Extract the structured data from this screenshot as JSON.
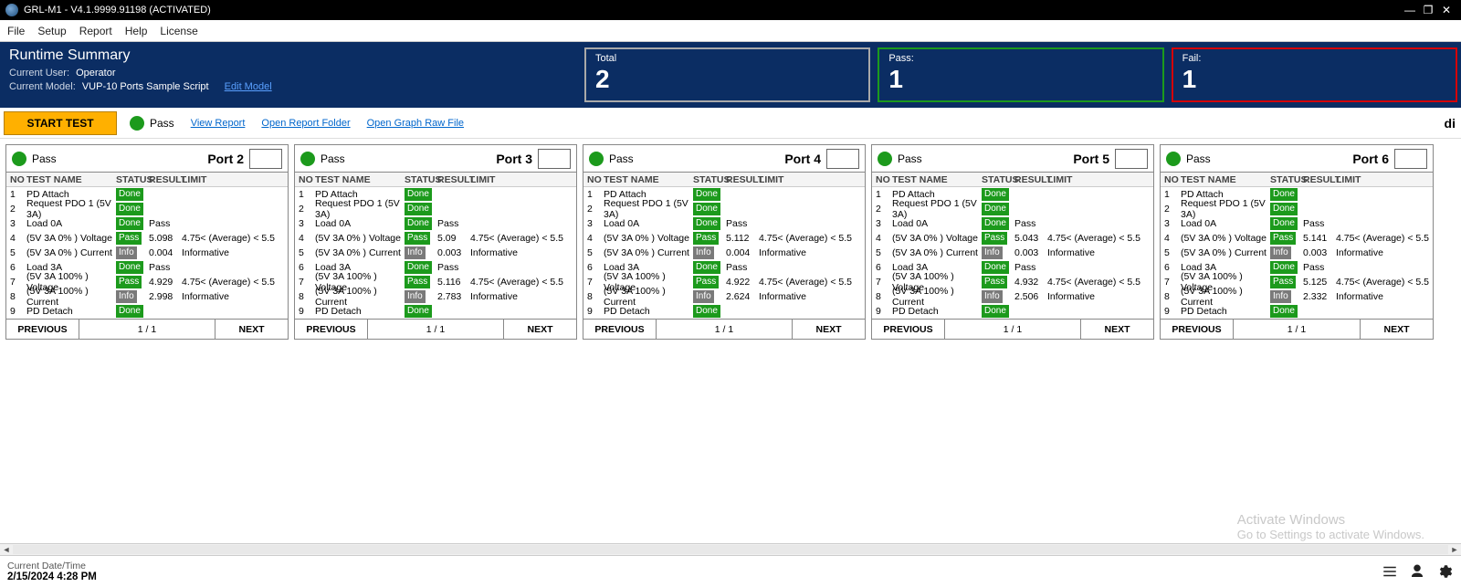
{
  "title_bar": {
    "title": "GRL-M1 - V4.1.9999.91198 (ACTIVATED)"
  },
  "menu": {
    "file": "File",
    "setup": "Setup",
    "report": "Report",
    "help": "Help",
    "license": "License"
  },
  "summary": {
    "heading": "Runtime Summary",
    "user_label": "Current User:",
    "user_value": "Operator",
    "model_label": "Current Model:",
    "model_value": "VUP-10 Ports Sample Script",
    "edit_model": "Edit Model",
    "total_label": "Total",
    "total_value": "2",
    "pass_label": "Pass:",
    "pass_value": "1",
    "fail_label": "Fail:",
    "fail_value": "1"
  },
  "toolbar": {
    "start": "START TEST",
    "overall": "Pass",
    "view_report": "View Report",
    "open_folder": "Open Report Folder",
    "open_graph": "Open Graph Raw File",
    "drag_hint": "di"
  },
  "headers": {
    "no": "NO",
    "name": "TEST NAME",
    "status": "STATUS",
    "result": "RESULT",
    "limit": "LIMIT"
  },
  "footer": {
    "prev": "PREVIOUS",
    "next": "NEXT",
    "page": "1 / 1"
  },
  "status_bar": {
    "label": "Current Date/Time",
    "value": "2/15/2024 4:28 PM"
  },
  "watermark": {
    "l1": "Activate Windows",
    "l2": "Go to Settings to activate Windows."
  },
  "ports": [
    {
      "title": "Port 2",
      "pf": "Pass",
      "rows": [
        {
          "no": "1",
          "name": "PD Attach",
          "status": "Done",
          "result": "",
          "limit": ""
        },
        {
          "no": "2",
          "name": "Request PDO 1 (5V 3A)",
          "status": "Done",
          "result": "",
          "limit": ""
        },
        {
          "no": "3",
          "name": "Load 0A",
          "status": "Done",
          "result": "Pass",
          "limit": ""
        },
        {
          "no": "4",
          "name": "(5V 3A 0% ) Voltage",
          "status": "Pass",
          "result": "5.098",
          "limit": "4.75< (Average) < 5.5"
        },
        {
          "no": "5",
          "name": "(5V 3A 0% ) Current",
          "status": "Info",
          "result": "0.004",
          "limit": "Informative"
        },
        {
          "no": "6",
          "name": "Load 3A",
          "status": "Done",
          "result": "Pass",
          "limit": ""
        },
        {
          "no": "7",
          "name": "(5V 3A 100% ) Voltage",
          "status": "Pass",
          "result": "4.929",
          "limit": "4.75< (Average) < 5.5"
        },
        {
          "no": "8",
          "name": "(5V 3A 100% ) Current",
          "status": "Info",
          "result": "2.998",
          "limit": "Informative"
        },
        {
          "no": "9",
          "name": "PD Detach",
          "status": "Done",
          "result": "",
          "limit": ""
        }
      ]
    },
    {
      "title": "Port 3",
      "pf": "Pass",
      "rows": [
        {
          "no": "1",
          "name": "PD Attach",
          "status": "Done",
          "result": "",
          "limit": ""
        },
        {
          "no": "2",
          "name": "Request PDO 1 (5V 3A)",
          "status": "Done",
          "result": "",
          "limit": ""
        },
        {
          "no": "3",
          "name": "Load 0A",
          "status": "Done",
          "result": "Pass",
          "limit": ""
        },
        {
          "no": "4",
          "name": "(5V 3A 0% ) Voltage",
          "status": "Pass",
          "result": "5.09",
          "limit": "4.75< (Average) < 5.5"
        },
        {
          "no": "5",
          "name": "(5V 3A 0% ) Current",
          "status": "Info",
          "result": "0.003",
          "limit": "Informative"
        },
        {
          "no": "6",
          "name": "Load 3A",
          "status": "Done",
          "result": "Pass",
          "limit": ""
        },
        {
          "no": "7",
          "name": "(5V 3A 100% ) Voltage",
          "status": "Pass",
          "result": "5.116",
          "limit": "4.75< (Average) < 5.5"
        },
        {
          "no": "8",
          "name": "(5V 3A 100% ) Current",
          "status": "Info",
          "result": "2.783",
          "limit": "Informative"
        },
        {
          "no": "9",
          "name": "PD Detach",
          "status": "Done",
          "result": "",
          "limit": ""
        }
      ]
    },
    {
      "title": "Port 4",
      "pf": "Pass",
      "rows": [
        {
          "no": "1",
          "name": "PD Attach",
          "status": "Done",
          "result": "",
          "limit": ""
        },
        {
          "no": "2",
          "name": "Request PDO 1 (5V 3A)",
          "status": "Done",
          "result": "",
          "limit": ""
        },
        {
          "no": "3",
          "name": "Load 0A",
          "status": "Done",
          "result": "Pass",
          "limit": ""
        },
        {
          "no": "4",
          "name": "(5V 3A 0% ) Voltage",
          "status": "Pass",
          "result": "5.112",
          "limit": "4.75< (Average) < 5.5"
        },
        {
          "no": "5",
          "name": "(5V 3A 0% ) Current",
          "status": "Info",
          "result": "0.004",
          "limit": "Informative"
        },
        {
          "no": "6",
          "name": "Load 3A",
          "status": "Done",
          "result": "Pass",
          "limit": ""
        },
        {
          "no": "7",
          "name": "(5V 3A 100% ) Voltage",
          "status": "Pass",
          "result": "4.922",
          "limit": "4.75< (Average) < 5.5"
        },
        {
          "no": "8",
          "name": "(5V 3A 100% ) Current",
          "status": "Info",
          "result": "2.624",
          "limit": "Informative"
        },
        {
          "no": "9",
          "name": "PD Detach",
          "status": "Done",
          "result": "",
          "limit": ""
        }
      ]
    },
    {
      "title": "Port 5",
      "pf": "Pass",
      "rows": [
        {
          "no": "1",
          "name": "PD Attach",
          "status": "Done",
          "result": "",
          "limit": ""
        },
        {
          "no": "2",
          "name": "Request PDO 1 (5V 3A)",
          "status": "Done",
          "result": "",
          "limit": ""
        },
        {
          "no": "3",
          "name": "Load 0A",
          "status": "Done",
          "result": "Pass",
          "limit": ""
        },
        {
          "no": "4",
          "name": "(5V 3A 0% ) Voltage",
          "status": "Pass",
          "result": "5.043",
          "limit": "4.75< (Average) < 5.5"
        },
        {
          "no": "5",
          "name": "(5V 3A 0% ) Current",
          "status": "Info",
          "result": "0.003",
          "limit": "Informative"
        },
        {
          "no": "6",
          "name": "Load 3A",
          "status": "Done",
          "result": "Pass",
          "limit": ""
        },
        {
          "no": "7",
          "name": "(5V 3A 100% ) Voltage",
          "status": "Pass",
          "result": "4.932",
          "limit": "4.75< (Average) < 5.5"
        },
        {
          "no": "8",
          "name": "(5V 3A 100% ) Current",
          "status": "Info",
          "result": "2.506",
          "limit": "Informative"
        },
        {
          "no": "9",
          "name": "PD Detach",
          "status": "Done",
          "result": "",
          "limit": ""
        }
      ]
    },
    {
      "title": "Port 6",
      "pf": "Pass",
      "rows": [
        {
          "no": "1",
          "name": "PD Attach",
          "status": "Done",
          "result": "",
          "limit": ""
        },
        {
          "no": "2",
          "name": "Request PDO 1 (5V 3A)",
          "status": "Done",
          "result": "",
          "limit": ""
        },
        {
          "no": "3",
          "name": "Load 0A",
          "status": "Done",
          "result": "Pass",
          "limit": ""
        },
        {
          "no": "4",
          "name": "(5V 3A 0% ) Voltage",
          "status": "Pass",
          "result": "5.141",
          "limit": "4.75< (Average) < 5.5"
        },
        {
          "no": "5",
          "name": "(5V 3A 0% ) Current",
          "status": "Info",
          "result": "0.003",
          "limit": "Informative"
        },
        {
          "no": "6",
          "name": "Load 3A",
          "status": "Done",
          "result": "Pass",
          "limit": ""
        },
        {
          "no": "7",
          "name": "(5V 3A 100% ) Voltage",
          "status": "Pass",
          "result": "5.125",
          "limit": "4.75< (Average) < 5.5"
        },
        {
          "no": "8",
          "name": "(5V 3A 100% ) Current",
          "status": "Info",
          "result": "2.332",
          "limit": "Informative"
        },
        {
          "no": "9",
          "name": "PD Detach",
          "status": "Done",
          "result": "",
          "limit": ""
        }
      ]
    }
  ]
}
